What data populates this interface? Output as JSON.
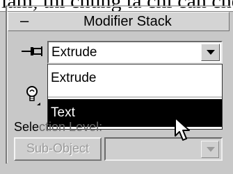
{
  "page_text_fragment": "làm, thì chúng ta chỉ cần chọn",
  "rollout": {
    "title": "Modifier Stack",
    "collapse_symbol": "–"
  },
  "modifier_combo": {
    "value": "Extrude",
    "arrow_icon": "dropdown-arrow-icon",
    "options": [
      "Extrude",
      "Text"
    ],
    "highlighted_option": "Text"
  },
  "selection": {
    "label_visible": "Sele",
    "label_partial": "ction Level:"
  },
  "sub_object": {
    "button_label": "Sub-Object",
    "level_value": ""
  },
  "icons": {
    "pin": "pin-stack-icon",
    "light": "lightbulb-icon",
    "cursor": "mouse-pointer-icon"
  }
}
